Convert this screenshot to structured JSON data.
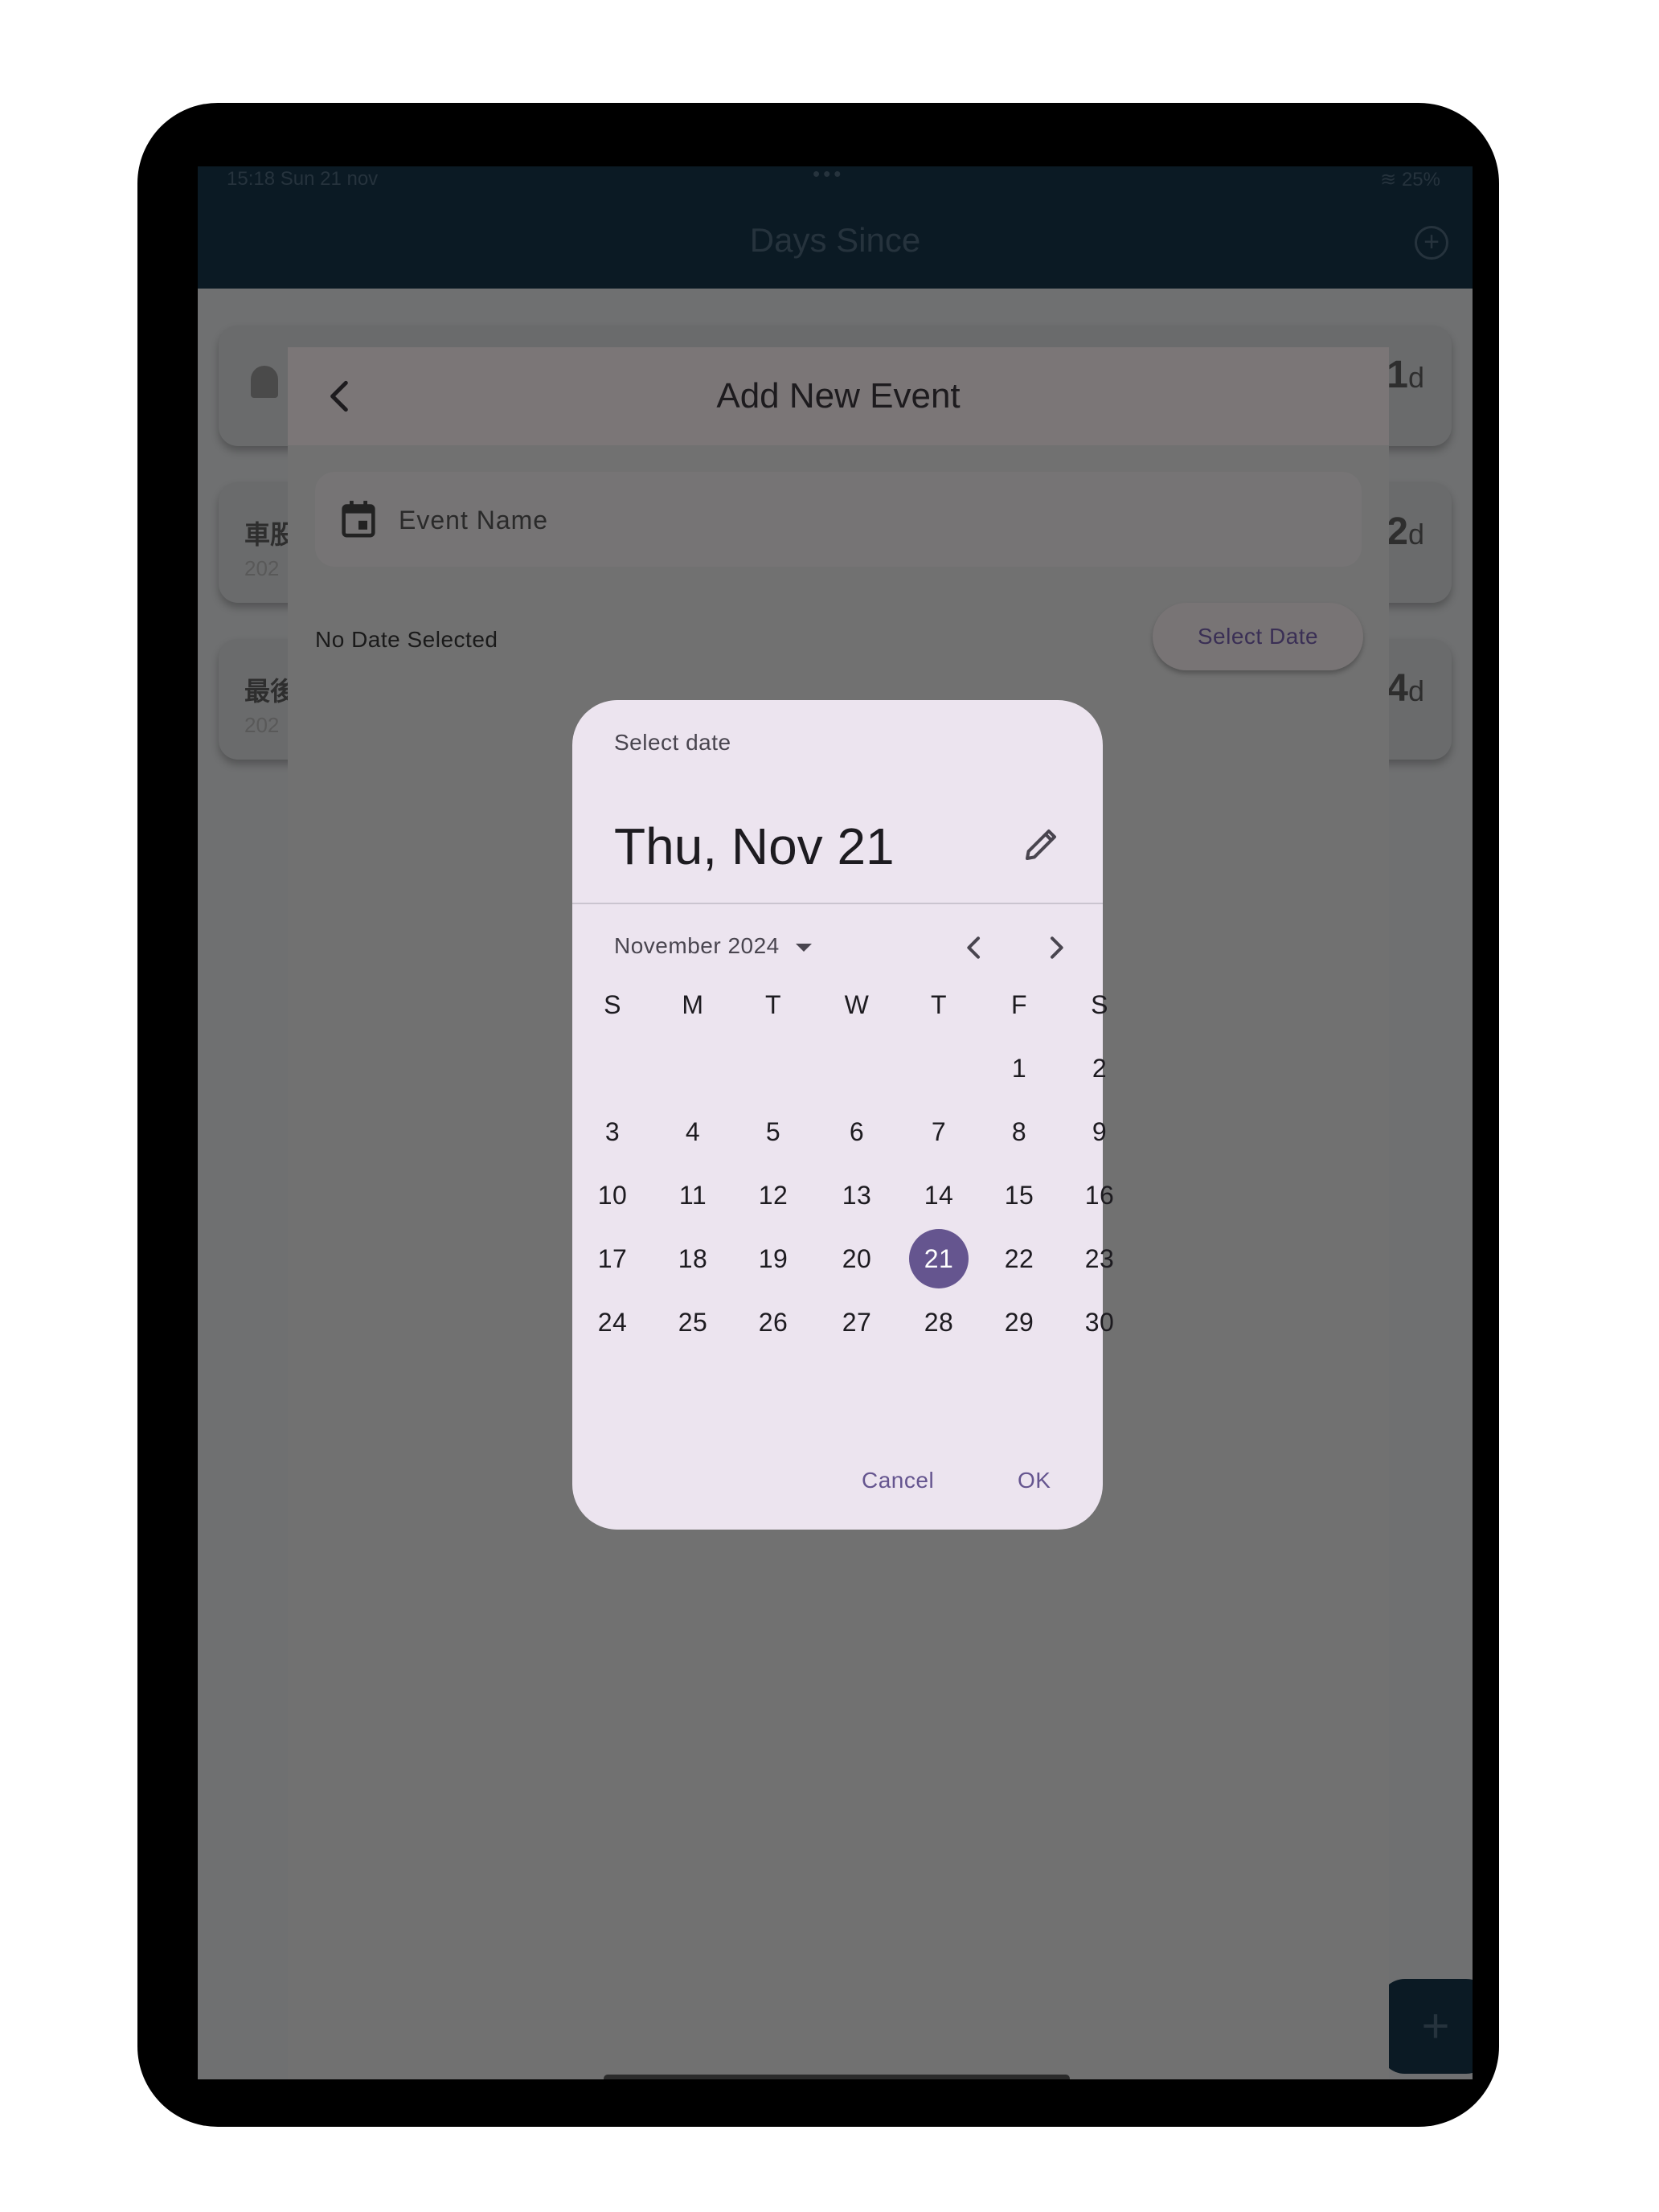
{
  "status_bar": {
    "time": "15:18",
    "date": "Sun 21 nov",
    "battery": "25%"
  },
  "app_bar": {
    "title": "Days Since"
  },
  "background_cards": [
    {
      "title": "",
      "subtitle": "",
      "days": "1",
      "unit": "d"
    },
    {
      "title": "車股",
      "subtitle": "202",
      "days": "2",
      "unit": "d"
    },
    {
      "title": "最後",
      "subtitle": "202",
      "days": "4",
      "unit": "d"
    }
  ],
  "sheet": {
    "title": "Add New Event",
    "event_name_placeholder": "Event Name",
    "no_date_text": "No Date Selected",
    "select_date_label": "Select Date"
  },
  "date_picker": {
    "label": "Select date",
    "headline": "Thu, Nov 21",
    "month_year": "November 2024",
    "weekdays": [
      "S",
      "M",
      "T",
      "W",
      "T",
      "F",
      "S"
    ],
    "first_weekday_index": 5,
    "days_in_month": 30,
    "selected_day": 21,
    "cancel_label": "Cancel",
    "ok_label": "OK",
    "accent_color": "#65558f"
  },
  "icons": {
    "back": "chevron-left-icon",
    "calendar": "calendar-icon",
    "edit": "pencil-icon",
    "prev_month": "chevron-left-icon",
    "next_month": "chevron-right-icon",
    "dropdown": "caret-down-icon",
    "add": "plus-icon"
  }
}
